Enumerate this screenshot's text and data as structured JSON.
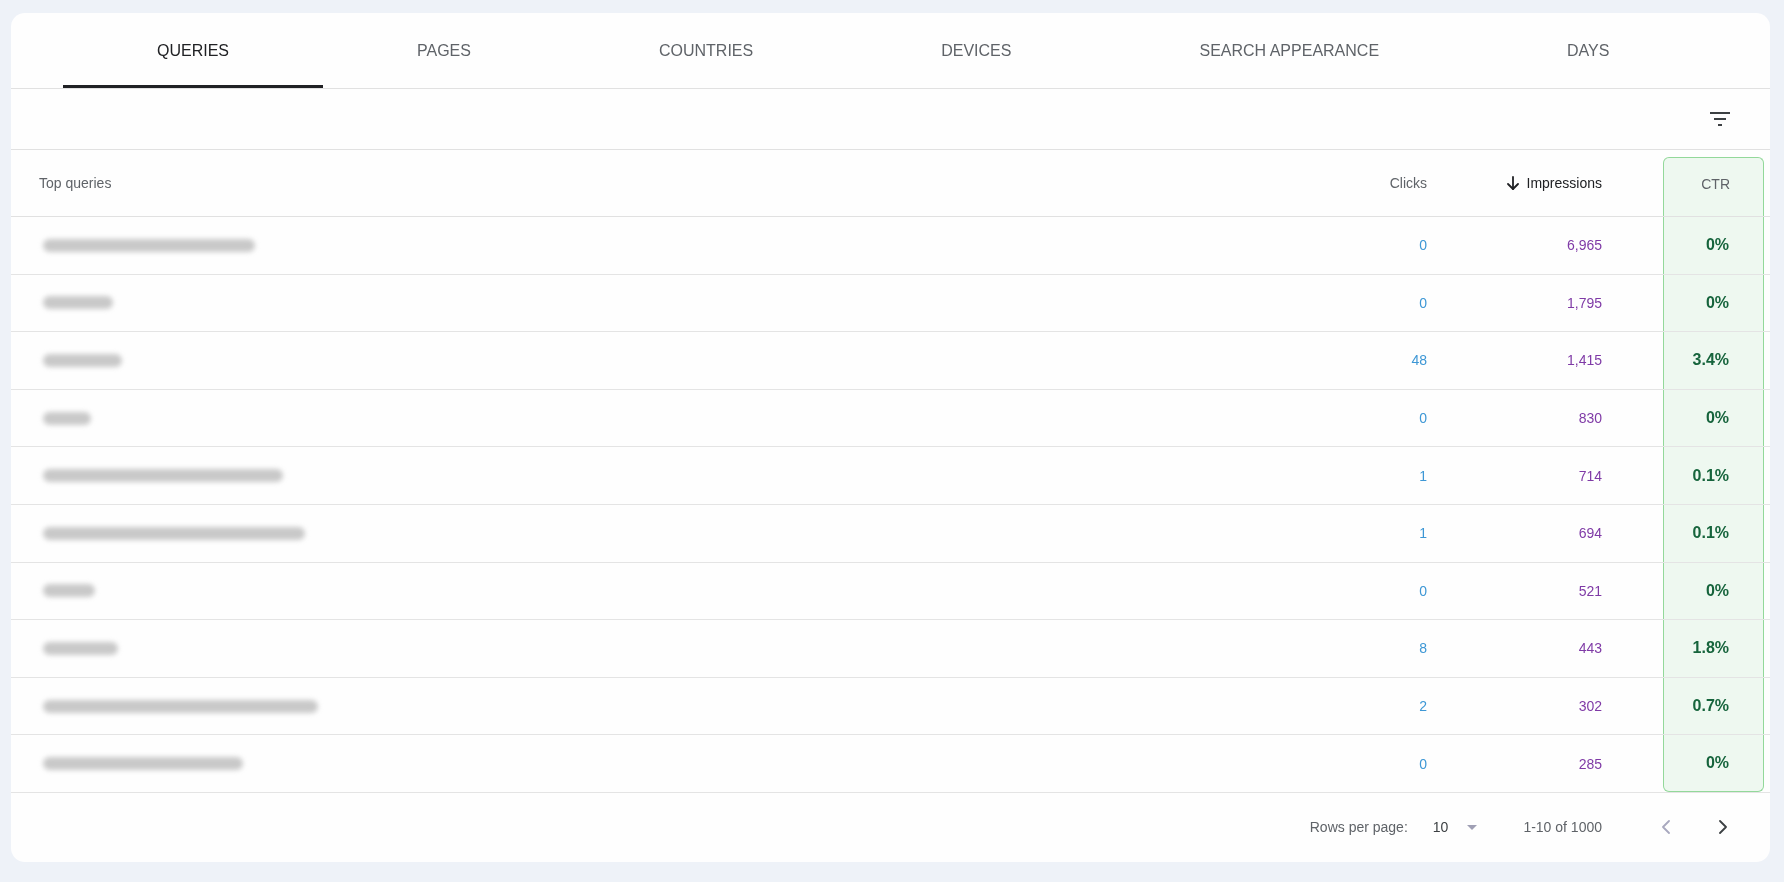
{
  "tabs": [
    {
      "label": "QUERIES",
      "selected": true
    },
    {
      "label": "PAGES",
      "selected": false
    },
    {
      "label": "COUNTRIES",
      "selected": false
    },
    {
      "label": "DEVICES",
      "selected": false
    },
    {
      "label": "SEARCH APPEARANCE",
      "selected": false
    },
    {
      "label": "DAYS",
      "selected": false
    }
  ],
  "table": {
    "columns": [
      {
        "label": "Top queries",
        "kind": "query",
        "sorted": false,
        "highlighted": false
      },
      {
        "label": "Clicks",
        "kind": "metric",
        "color": "#3d97d5",
        "sorted": false,
        "highlighted": false
      },
      {
        "label": "Impressions",
        "kind": "metric",
        "color": "#7f3aa6",
        "sorted": true,
        "highlighted": false
      },
      {
        "label": "CTR",
        "kind": "metric",
        "color": "#16643c",
        "sorted": false,
        "highlighted": true
      }
    ],
    "rows": [
      {
        "cells": [
          "",
          "0",
          "6,965",
          "0%"
        ]
      },
      {
        "cells": [
          "",
          "0",
          "1,795",
          "0%"
        ]
      },
      {
        "cells": [
          "",
          "48",
          "1,415",
          "3.4%"
        ]
      },
      {
        "cells": [
          "",
          "0",
          "830",
          "0%"
        ]
      },
      {
        "cells": [
          "",
          "1",
          "714",
          "0.1%"
        ]
      },
      {
        "cells": [
          "",
          "1",
          "694",
          "0.1%"
        ]
      },
      {
        "cells": [
          "",
          "0",
          "521",
          "0%"
        ]
      },
      {
        "cells": [
          "",
          "8",
          "443",
          "1.8%"
        ]
      },
      {
        "cells": [
          "",
          "2",
          "302",
          "0.7%"
        ]
      },
      {
        "cells": [
          "",
          "0",
          "285",
          "0%"
        ]
      }
    ]
  },
  "pagination": {
    "label": "Rows per page:",
    "rows_per_page": "10",
    "range": "1-10 of 1000",
    "previous": {
      "disabled": true
    },
    "next": {
      "disabled": false
    }
  }
}
